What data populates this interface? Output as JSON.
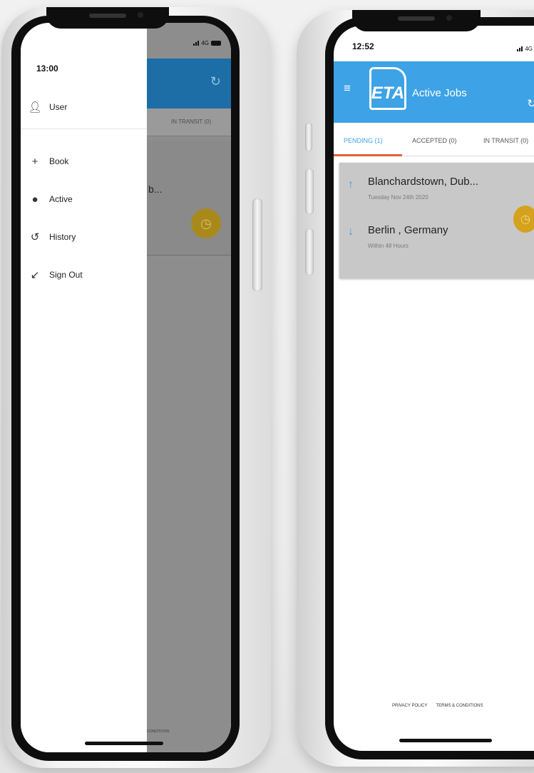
{
  "left_phone": {
    "status": {
      "time": "13:00",
      "network": "4G"
    },
    "drawer": {
      "user_label": "User",
      "items": [
        {
          "icon": "plus-icon",
          "glyph": "+",
          "label": "Book"
        },
        {
          "icon": "clock-filled-icon",
          "glyph": "●",
          "label": "Active"
        },
        {
          "icon": "history-icon",
          "glyph": "↺",
          "label": "History"
        },
        {
          "icon": "sign-out-icon",
          "glyph": "↙",
          "label": "Sign Out"
        }
      ]
    },
    "background": {
      "tab_in_transit": "IN TRANSIT (0)",
      "card_text": "b...",
      "footer": "CONDITIONS"
    }
  },
  "right_phone": {
    "status": {
      "time": "12:52",
      "network": "4G"
    },
    "app": {
      "logo_text": "ETA",
      "title": "Active Jobs",
      "colors": {
        "primary": "#3da2e6",
        "accent": "#e0623a",
        "clock": "#d4a21d"
      }
    },
    "tabs": [
      {
        "label": "PENDING (1)",
        "active": true
      },
      {
        "label": "ACCEPTED (0)",
        "active": false
      },
      {
        "label": "IN TRANSIT (0)",
        "active": false
      }
    ],
    "job": {
      "pickup": "Blanchardstown, Dub...",
      "pickup_date": "Tuesday Nov 24th 2020",
      "dropoff": "Berlin , Germany",
      "dropoff_time": "Within 48 Hours"
    },
    "footer": {
      "privacy": "PRIVACY POLICY",
      "terms": "TERMS & CONDITIONS"
    }
  }
}
